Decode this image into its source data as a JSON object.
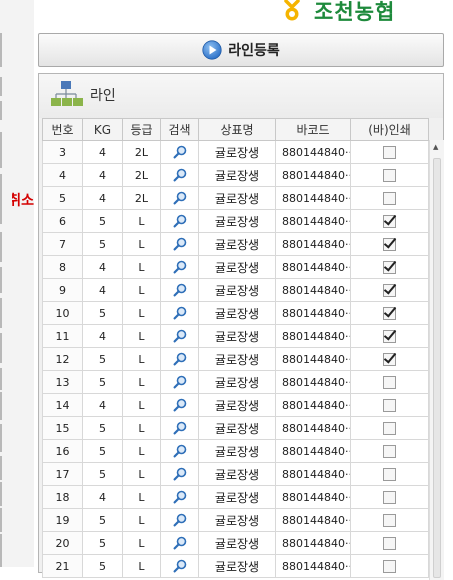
{
  "logo": {
    "text": "조천농협"
  },
  "register_button": {
    "label": "라인등록"
  },
  "panel": {
    "title": "라인"
  },
  "left_panel": {
    "cancel_label": "취소"
  },
  "grid": {
    "headers": [
      "번호",
      "KG",
      "등급",
      "검색",
      "상표명",
      "바코드",
      "(바)인쇄"
    ],
    "rows": [
      {
        "no": "3",
        "kg": "4",
        "grade": "2L",
        "name": "귤로장생",
        "barcode": "880144840···",
        "print": false
      },
      {
        "no": "4",
        "kg": "4",
        "grade": "2L",
        "name": "귤로장생",
        "barcode": "880144840···",
        "print": false
      },
      {
        "no": "5",
        "kg": "4",
        "grade": "2L",
        "name": "귤로장생",
        "barcode": "880144840···",
        "print": false
      },
      {
        "no": "6",
        "kg": "5",
        "grade": "L",
        "name": "귤로장생",
        "barcode": "880144840···",
        "print": true
      },
      {
        "no": "7",
        "kg": "5",
        "grade": "L",
        "name": "귤로장생",
        "barcode": "880144840···",
        "print": true
      },
      {
        "no": "8",
        "kg": "4",
        "grade": "L",
        "name": "귤로장생",
        "barcode": "880144840···",
        "print": true
      },
      {
        "no": "9",
        "kg": "4",
        "grade": "L",
        "name": "귤로장생",
        "barcode": "880144840···",
        "print": true
      },
      {
        "no": "10",
        "kg": "5",
        "grade": "L",
        "name": "귤로장생",
        "barcode": "880144840···",
        "print": true
      },
      {
        "no": "11",
        "kg": "4",
        "grade": "L",
        "name": "귤로장생",
        "barcode": "880144840···",
        "print": true
      },
      {
        "no": "12",
        "kg": "5",
        "grade": "L",
        "name": "귤로장생",
        "barcode": "880144840···",
        "print": true
      },
      {
        "no": "13",
        "kg": "5",
        "grade": "L",
        "name": "귤로장생",
        "barcode": "880144840···",
        "print": false
      },
      {
        "no": "14",
        "kg": "4",
        "grade": "L",
        "name": "귤로장생",
        "barcode": "880144840···",
        "print": false
      },
      {
        "no": "15",
        "kg": "5",
        "grade": "L",
        "name": "귤로장생",
        "barcode": "880144840···",
        "print": false
      },
      {
        "no": "16",
        "kg": "5",
        "grade": "L",
        "name": "귤로장생",
        "barcode": "880144840···",
        "print": false
      },
      {
        "no": "17",
        "kg": "5",
        "grade": "L",
        "name": "귤로장생",
        "barcode": "880144840···",
        "print": false
      },
      {
        "no": "18",
        "kg": "4",
        "grade": "L",
        "name": "귤로장생",
        "barcode": "880144840···",
        "print": false
      },
      {
        "no": "19",
        "kg": "5",
        "grade": "L",
        "name": "귤로장생",
        "barcode": "880144840···",
        "print": false
      },
      {
        "no": "20",
        "kg": "5",
        "grade": "L",
        "name": "귤로장생",
        "barcode": "880144840···",
        "print": false
      },
      {
        "no": "21",
        "kg": "5",
        "grade": "L",
        "name": "귤로장생",
        "barcode": "880144840···",
        "print": false
      }
    ]
  },
  "icons": {
    "search": "search-icon",
    "register": "play-icon",
    "panel": "hierarchy-icon",
    "logo": "nh-logo-icon"
  },
  "colors": {
    "logo_green": "#1e8a3c",
    "logo_yellow": "#f5b400",
    "cancel_red": "#d40000",
    "play_blue": "#2f73c9"
  }
}
